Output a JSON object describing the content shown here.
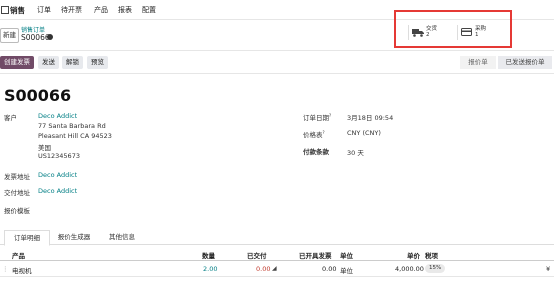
{
  "topbar": {
    "app_name": "销售",
    "menu": [
      "订单",
      "待开票",
      "产品",
      "报表",
      "配置"
    ]
  },
  "control": {
    "new_button": "新建",
    "breadcrumb_parent": "销售订单",
    "breadcrumb_current": "S00066"
  },
  "smart_buttons": [
    {
      "label": "交货",
      "count": "2",
      "icon": "truck-icon"
    },
    {
      "label": "采购",
      "count": "1",
      "icon": "credit-card-icon"
    }
  ],
  "actions": {
    "create_invoice": "创建发票",
    "send": "发送",
    "unlock": "解锁",
    "preview": "预览"
  },
  "status_steps": [
    "报价单",
    "已发送报价单"
  ],
  "record": {
    "name": "S00066",
    "customer_label": "客户",
    "customer_name": "Deco Addict",
    "address_lines": [
      "77 Santa Barbara Rd",
      "Pleasant Hill CA 94523",
      "美国",
      "US12345673"
    ],
    "invoice_address_label": "发票地址",
    "invoice_address": "Deco Addict",
    "delivery_address_label": "交付地址",
    "delivery_address": "Deco Addict",
    "quote_template_label": "报价模板",
    "order_date_label": "订单日期",
    "order_date": "3月18日 09:54",
    "pricelist_label": "价格表",
    "pricelist": "CNY (CNY)",
    "payment_terms_label": "付款条款",
    "payment_terms": "30 天",
    "help_mark": "?"
  },
  "tabs": [
    "订单明细",
    "报价生成器",
    "其他信息"
  ],
  "table": {
    "headers": {
      "product": "产品",
      "quantity": "数量",
      "delivered": "已交付",
      "invoiced": "已开具发票",
      "unit": "单位",
      "unit_price": "单价",
      "taxes": "税项"
    },
    "rows": [
      {
        "product": "电视机",
        "quantity": "2.00",
        "delivered": "0.00",
        "invoiced": "0.00",
        "unit": "单位",
        "unit_price": "4,000.00",
        "tax": "15%",
        "currency": "¥"
      }
    ]
  },
  "colors": {
    "brand": "#714b67",
    "link": "#017e84",
    "highlight": "#e53935"
  }
}
